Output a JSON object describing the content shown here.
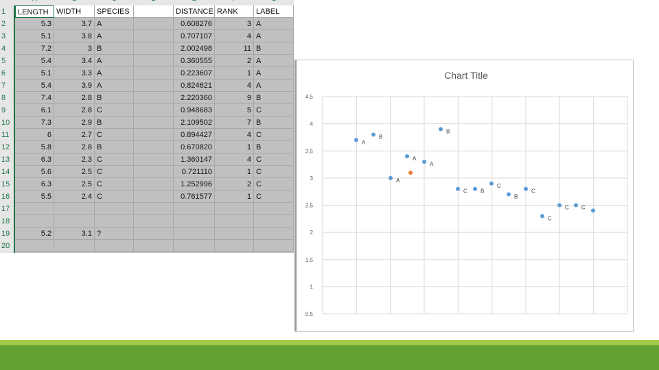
{
  "sheet": {
    "columns": [
      "A",
      "B",
      "C",
      "D",
      "E",
      "F",
      "G"
    ],
    "header": [
      "LENGTH",
      "WIDTH",
      "SPECIES",
      "",
      "DISTANCE",
      "RANK",
      "LABEL"
    ],
    "rows": [
      [
        "5.3",
        "3.7",
        "A",
        "",
        "0.608276",
        "3",
        "A"
      ],
      [
        "5.1",
        "3.8",
        "A",
        "",
        "0.707107",
        "4",
        "A"
      ],
      [
        "7.2",
        "3",
        "B",
        "",
        "2.002498",
        "11",
        "B"
      ],
      [
        "5.4",
        "3.4",
        "A",
        "",
        "0.360555",
        "2",
        "A"
      ],
      [
        "5.1",
        "3.3",
        "A",
        "",
        "0.223607",
        "1",
        "A"
      ],
      [
        "5.4",
        "3.9",
        "A",
        "",
        "0.824621",
        "4",
        "A"
      ],
      [
        "7.4",
        "2.8",
        "B",
        "",
        "2.220360",
        "9",
        "B"
      ],
      [
        "6.1",
        "2.8",
        "C",
        "",
        "0.948683",
        "5",
        "C"
      ],
      [
        "7.3",
        "2.9",
        "B",
        "",
        "2.109502",
        "7",
        "B"
      ],
      [
        "6",
        "2.7",
        "C",
        "",
        "0.894427",
        "4",
        "C"
      ],
      [
        "5.8",
        "2.8",
        "B",
        "",
        "0.670820",
        "1",
        "B"
      ],
      [
        "6.3",
        "2.3",
        "C",
        "",
        "1.360147",
        "4",
        "C"
      ],
      [
        "5.6",
        "2.5",
        "C",
        "",
        "0.721110",
        "1",
        "C"
      ],
      [
        "6.3",
        "2.5",
        "C",
        "",
        "1.252996",
        "2",
        "C"
      ],
      [
        "5.5",
        "2.4",
        "C",
        "",
        "0.761577",
        "1",
        "C"
      ],
      [
        "",
        "",
        "",
        "",
        "",
        "",
        ""
      ],
      [
        "",
        "",
        "",
        "",
        "",
        "",
        ""
      ],
      [
        "5.2",
        "3.1",
        "?",
        "",
        "",
        "",
        ""
      ],
      [
        "",
        "",
        "",
        "",
        "",
        "",
        ""
      ]
    ],
    "row_numbers": [
      "1",
      "2",
      "3",
      "4",
      "5",
      "6",
      "7",
      "8",
      "9",
      "10",
      "11",
      "12",
      "13",
      "14",
      "15",
      "16",
      "17",
      "18",
      "19",
      "20"
    ]
  },
  "chart_data": {
    "type": "scatter",
    "title": "Chart Title",
    "ylim": [
      0.5,
      4.5
    ],
    "yticks": [
      "4.5",
      "4",
      "3.5",
      "3",
      "2.5",
      "2",
      "1.5",
      "1",
      "0.5"
    ],
    "grid": true,
    "series": [
      {
        "color": "#5b9bd5",
        "points": [
          {
            "y": 3.7,
            "label": "A"
          },
          {
            "y": 3.8,
            "label": "B"
          },
          {
            "y": 3.0,
            "label": "A"
          },
          {
            "y": 3.4,
            "label": "A"
          },
          {
            "y": 3.3,
            "label": "A"
          },
          {
            "y": 3.9,
            "label": "B"
          },
          {
            "y": 2.8,
            "label": "C"
          },
          {
            "y": 2.8,
            "label": "B"
          },
          {
            "y": 2.9,
            "label": "C"
          },
          {
            "y": 2.7,
            "label": "B"
          },
          {
            "y": 2.8,
            "label": "C"
          },
          {
            "y": 2.3,
            "label": "C"
          },
          {
            "y": 2.5,
            "label": "C"
          },
          {
            "y": 2.5,
            "label": "C"
          },
          {
            "y": 2.4,
            "label": ""
          }
        ]
      },
      {
        "color": "#ed7d31",
        "points": [
          {
            "y": 3.1,
            "label": ""
          }
        ]
      }
    ]
  }
}
